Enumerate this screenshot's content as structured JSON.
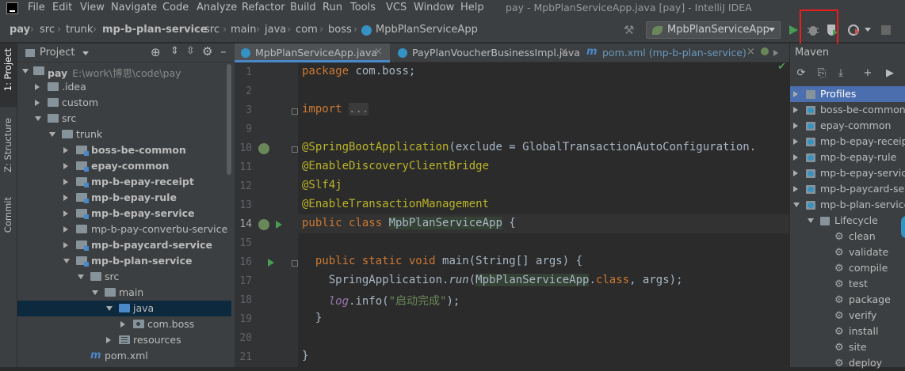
{
  "window": {
    "title": "pay - MpbPlanServiceApp.java [pay] - IntelliJ IDEA"
  },
  "menu": [
    "File",
    "Edit",
    "View",
    "Navigate",
    "Code",
    "Analyze",
    "Refactor",
    "Build",
    "Run",
    "Tools",
    "VCS",
    "Window",
    "Help"
  ],
  "breadcrumb": [
    "pay",
    "src",
    "trunk",
    "mp-b-plan-service",
    "src",
    "main",
    "java",
    "com",
    "boss",
    "MpbPlanServiceApp"
  ],
  "run_config": {
    "label": "MpbPlanServiceApp"
  },
  "left_strip": {
    "tabs": [
      "1: Project",
      "Z: Structure",
      "Commit"
    ]
  },
  "project": {
    "header": "Project",
    "root_label": "pay",
    "root_path": "E:\\work\\博思\\code\\pay",
    "items": [
      ".idea",
      "custom",
      "src",
      "trunk",
      "boss-be-common",
      "epay-common",
      "mp-b-epay-receipt",
      "mp-b-epay-rule",
      "mp-b-epay-service",
      "mp-b-pay-converbu-service",
      "mp-b-paycard-service",
      "mp-b-plan-service",
      "src",
      "main",
      "java",
      "com.boss",
      "resources",
      "pom.xml"
    ]
  },
  "editor": {
    "tabs": [
      "MpbPlanServiceApp.java",
      "PayPlanVoucherBusinessImpl.java",
      "pom.xml (mp-b-plan-service)"
    ],
    "line_numbers": [
      "1",
      "2",
      "3",
      "9",
      "10",
      "11",
      "12",
      "13",
      "14",
      "15",
      "16",
      "17",
      "18",
      "19",
      "20",
      "21"
    ],
    "code": {
      "l1_kw": "package",
      "l1_rest": " com.boss;",
      "l3_kw": "import",
      "l3_fold": "...",
      "l10_an": "@SpringBootApplication",
      "l10_rest": "(exclude = GlobalTransactionAutoConfiguration.",
      "l11_an": "@EnableDiscoveryClientBridge",
      "l12_an": "@Slf4j",
      "l13_an": "@EnableTransactionManagement",
      "l14_kw": "public class ",
      "l14_cls": "MpbPlanServiceApp",
      "l14_rest": " {",
      "l16_kw": "public static void ",
      "l16_rest": "main(String[] args) {",
      "l17_pre": "SpringApplication.",
      "l17_m": "run",
      "l17_open": "(",
      "l17_cls": "MpbPlanServiceApp",
      "l17_dot": ".",
      "l17_kw": "class",
      "l17_rest": ", args);",
      "l18_fld": "log",
      "l18_mid": ".info(",
      "l18_str": "\"启动完成\"",
      "l18_end": ");",
      "l19": "}",
      "l21": "}"
    }
  },
  "maven": {
    "header": "Maven",
    "items": [
      "Profiles",
      "boss-be-common",
      "epay-common",
      "mp-b-epay-receipt",
      "mp-b-epay-rule",
      "mp-b-epay-service",
      "mp-b-paycard-service",
      "mp-b-plan-service",
      "Lifecycle",
      "clean",
      "validate",
      "compile",
      "test",
      "package",
      "verify",
      "install",
      "site",
      "deploy"
    ]
  },
  "colors": {
    "accent": "#4a88c7",
    "highlight_box": "#e81e1e",
    "run_green": "#499c54"
  }
}
